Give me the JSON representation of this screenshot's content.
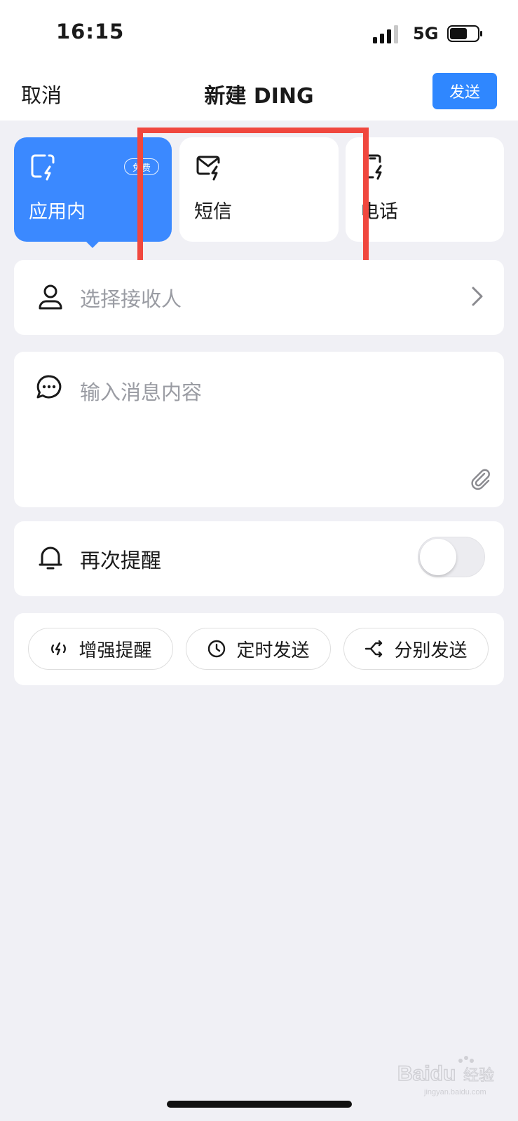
{
  "status_bar": {
    "time": "16:15",
    "network": "5G"
  },
  "nav": {
    "cancel": "取消",
    "title": "新建 DING",
    "send": "发送"
  },
  "ding_types": [
    {
      "label": "应用内",
      "badge": "免费",
      "selected": true
    },
    {
      "label": "短信",
      "selected": false
    },
    {
      "label": "电话",
      "selected": false
    }
  ],
  "recipient": {
    "placeholder": "选择接收人"
  },
  "message": {
    "placeholder": "输入消息内容"
  },
  "reminder": {
    "label": "再次提醒",
    "enabled": false
  },
  "actions": [
    {
      "label": "增强提醒",
      "icon": "signal-wave-icon"
    },
    {
      "label": "定时发送",
      "icon": "clock-icon"
    },
    {
      "label": "分别发送",
      "icon": "split-arrow-icon"
    }
  ],
  "watermark": {
    "brand": "Baidu",
    "text": "经验",
    "url": "jingyan.baidu.com"
  },
  "colors": {
    "accent": "#3b89ff",
    "highlight": "#f0473e",
    "background": "#f0f0f5"
  }
}
